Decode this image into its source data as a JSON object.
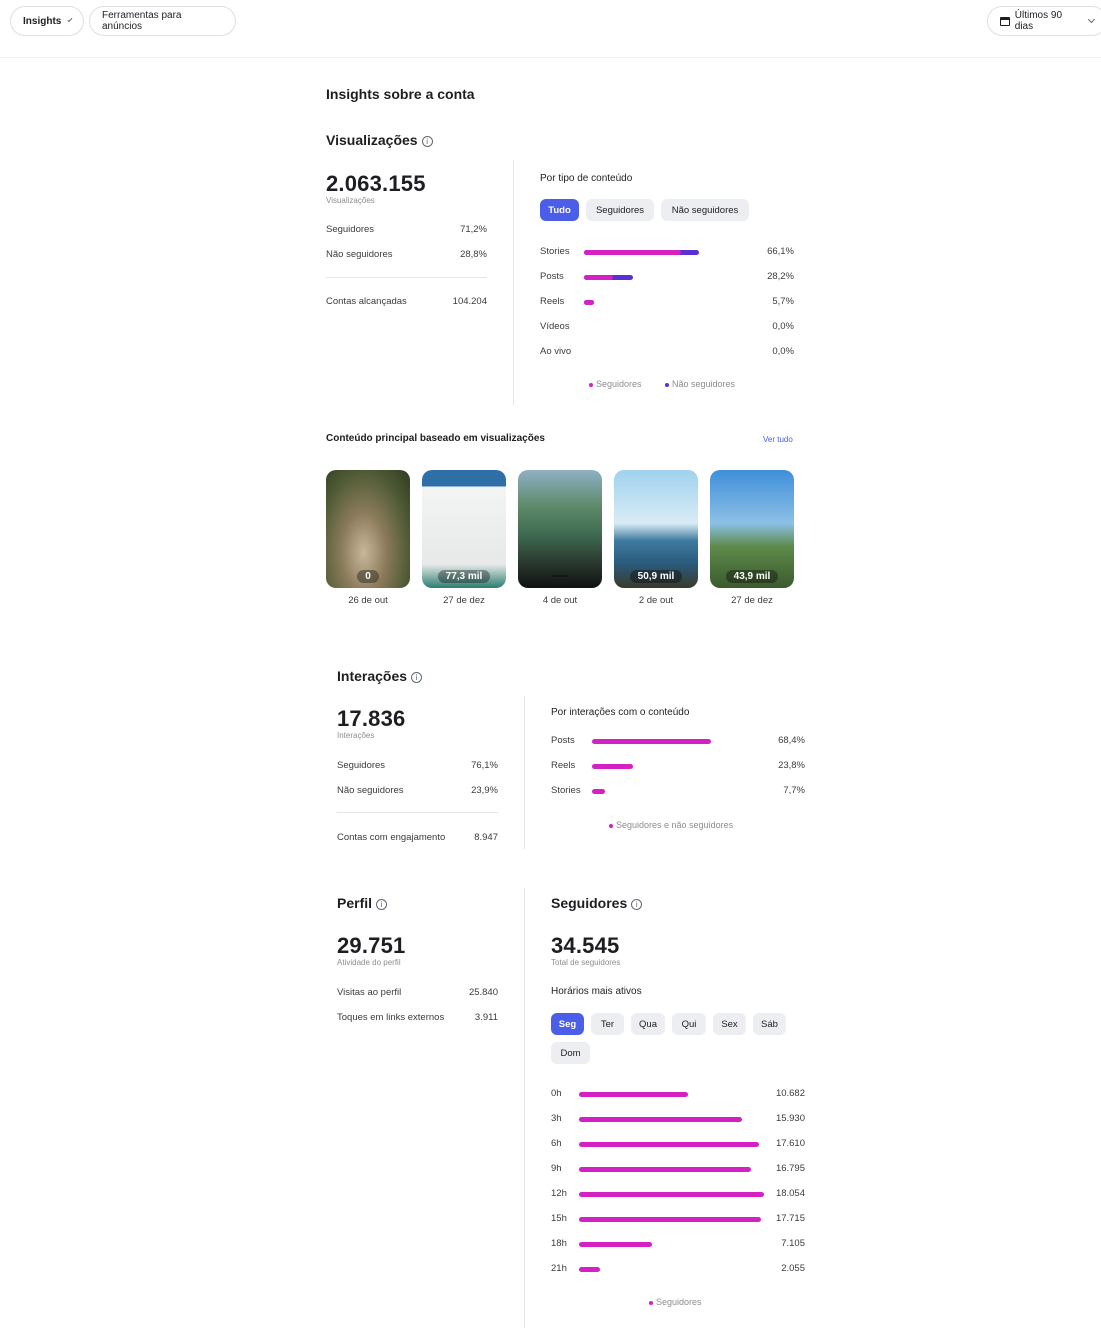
{
  "topbar": {
    "insights_label": "Insights",
    "tools_label": "Ferramentas para anúncios",
    "range_label": "Últimos 90 dias"
  },
  "page_title": "Insights sobre a conta",
  "views": {
    "title": "Visualizações",
    "total": "2.063.155",
    "total_caption": "Visualizações",
    "rows": [
      {
        "label": "Seguidores",
        "value": "71,2%"
      },
      {
        "label": "Não seguidores",
        "value": "28,8%"
      }
    ],
    "reach_label": "Contas alcançadas",
    "reach_value": "104.204",
    "by_type": {
      "title": "Por tipo de conteúdo",
      "tabs": [
        "Tudo",
        "Seguidores",
        "Não seguidores"
      ],
      "items": [
        {
          "label": "Stories",
          "value": "66,1%",
          "followers": 0.83,
          "nonfollowers": 0.17,
          "share": 0.661
        },
        {
          "label": "Posts",
          "value": "28,2%",
          "followers": 0.55,
          "nonfollowers": 0.45,
          "share": 0.282
        },
        {
          "label": "Reels",
          "value": "5,7%",
          "followers": 1.0,
          "nonfollowers": 0.0,
          "share": 0.057
        },
        {
          "label": "Vídeos",
          "value": "0,0%",
          "followers": 0,
          "nonfollowers": 0,
          "share": 0
        },
        {
          "label": "Ao vivo",
          "value": "0,0%",
          "followers": 0,
          "nonfollowers": 0,
          "share": 0
        }
      ],
      "legend_followers": "Seguidores",
      "legend_nonfollowers": "Não seguidores",
      "color_followers": "#d321c4",
      "color_nonfollowers": "#5b2fd6"
    }
  },
  "top_content": {
    "title": "Conteúdo principal baseado em visualizações",
    "see_all": "Ver tudo",
    "items": [
      {
        "value": "0",
        "date": "26 de out"
      },
      {
        "value": "77,3 mil",
        "date": "27 de dez"
      },
      {
        "value": "",
        "date": "4 de out"
      },
      {
        "value": "50,9 mil",
        "date": "2 de out"
      },
      {
        "value": "43,9 mil",
        "date": "27 de dez"
      }
    ]
  },
  "interactions": {
    "title": "Interações",
    "total": "17.836",
    "total_caption": "Interações",
    "rows": [
      {
        "label": "Seguidores",
        "value": "76,1%"
      },
      {
        "label": "Não seguidores",
        "value": "23,9%"
      }
    ],
    "engaged_label": "Contas com engajamento",
    "engaged_value": "8.947",
    "by_content": {
      "title": "Por interações com o conteúdo",
      "items": [
        {
          "label": "Posts",
          "value": "68,4%",
          "share": 0.684
        },
        {
          "label": "Reels",
          "value": "23,8%",
          "share": 0.238
        },
        {
          "label": "Stories",
          "value": "7,7%",
          "share": 0.077
        }
      ],
      "legend": "Seguidores e não seguidores"
    }
  },
  "profile": {
    "title": "Perfil",
    "total": "29.751",
    "total_caption": "Atividade do perfil",
    "rows": [
      {
        "label": "Visitas ao perfil",
        "value": "25.840"
      },
      {
        "label": "Toques em links externos",
        "value": "3.911"
      }
    ]
  },
  "followers": {
    "title": "Seguidores",
    "total": "34.545",
    "total_caption": "Total de seguidores",
    "active_title": "Horários mais ativos",
    "days": [
      "Seg",
      "Ter",
      "Qua",
      "Qui",
      "Sex",
      "Sáb",
      "Dom"
    ],
    "active_day": "Seg",
    "hours": [
      {
        "label": "0h",
        "value": "10.682",
        "n": 10682
      },
      {
        "label": "3h",
        "value": "15.930",
        "n": 15930
      },
      {
        "label": "6h",
        "value": "17.610",
        "n": 17610
      },
      {
        "label": "9h",
        "value": "16.795",
        "n": 16795
      },
      {
        "label": "12h",
        "value": "18.054",
        "n": 18054
      },
      {
        "label": "15h",
        "value": "17.715",
        "n": 17715
      },
      {
        "label": "18h",
        "value": "7.105",
        "n": 7105
      },
      {
        "label": "21h",
        "value": "2.055",
        "n": 2055
      }
    ],
    "legend": "Seguidores"
  }
}
